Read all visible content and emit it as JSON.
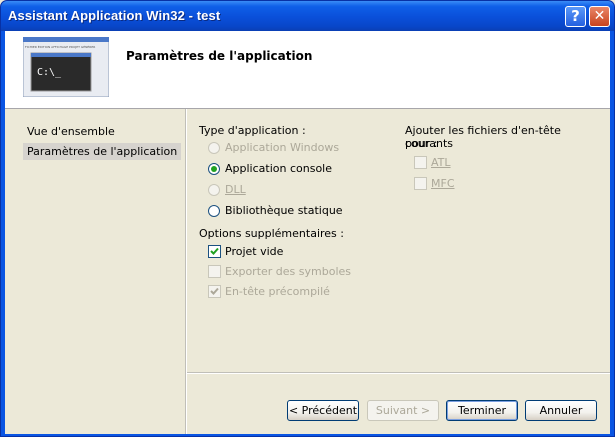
{
  "window": {
    "title": "Assistant Application Win32 - test",
    "help_glyph": "?",
    "close_glyph": "✕"
  },
  "header": {
    "title": "Paramètres de l'application",
    "banner_prompt": "C:\\_",
    "banner_menu": "FICHIER ÉDITION AFFICHAGE PROJET GÉNÉRER"
  },
  "sidebar": {
    "items": [
      {
        "label": "Vue d'ensemble",
        "selected": false
      },
      {
        "label": "Paramètres de l'application",
        "selected": true
      }
    ]
  },
  "app_type": {
    "heading": "Type d'application :",
    "options": [
      {
        "label": "Application Windows",
        "checked": false,
        "enabled": false
      },
      {
        "label": "Application console",
        "checked": true,
        "enabled": true
      },
      {
        "label": "DLL",
        "checked": false,
        "enabled": false
      },
      {
        "label": "Bibliothèque statique",
        "checked": false,
        "enabled": true
      }
    ]
  },
  "extra_options": {
    "heading": "Options supplémentaires :",
    "options": [
      {
        "label": "Projet vide",
        "checked": true,
        "enabled": true
      },
      {
        "label": "Exporter des symboles",
        "checked": false,
        "enabled": false
      },
      {
        "label": "En-tête précompilé",
        "checked": true,
        "enabled": false
      }
    ]
  },
  "headers": {
    "heading_line1": "Ajouter les fichiers d'en-tête courants",
    "heading_line2": "pour :",
    "options": [
      {
        "label": "ATL",
        "checked": false,
        "enabled": false
      },
      {
        "label": "MFC",
        "checked": false,
        "enabled": false
      }
    ]
  },
  "buttons": {
    "previous": "< Précédent",
    "next": "Suivant >",
    "finish": "Terminer",
    "cancel": "Annuler"
  },
  "colors": {
    "titlebar": "#0a55e3",
    "radio_dot": "#21a121",
    "disabled_text": "#aca899"
  }
}
